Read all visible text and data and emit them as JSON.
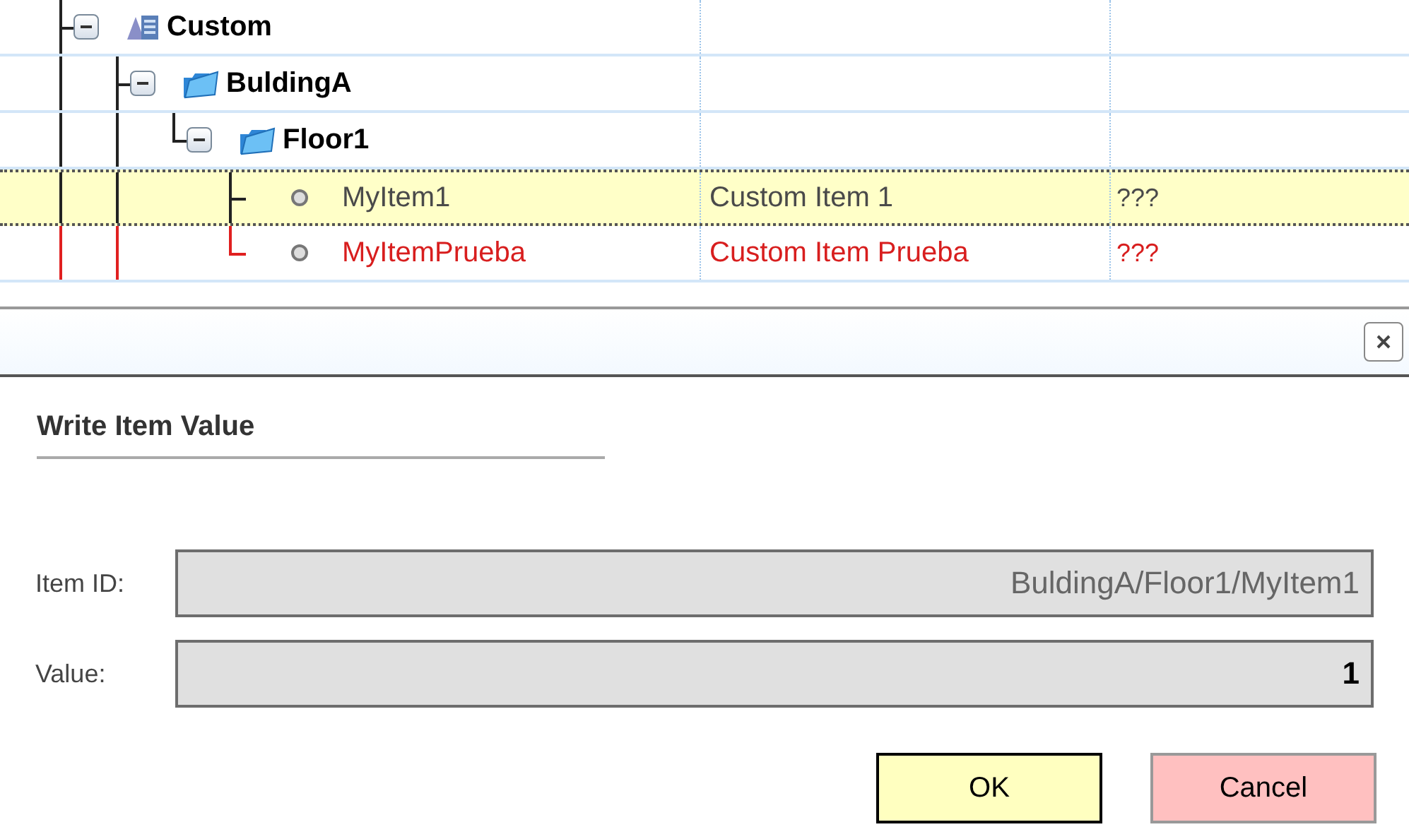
{
  "tree": [
    {
      "label": "Custom",
      "kind": "custom",
      "expanded": true,
      "last": false,
      "children": [
        {
          "label": "BuldingA",
          "kind": "folder",
          "expanded": true,
          "last": false,
          "children": [
            {
              "label": "Floor1",
              "kind": "folder",
              "expanded": true,
              "last": true,
              "children": [
                {
                  "label": "MyItem1",
                  "kind": "item",
                  "selected": true,
                  "error": false,
                  "last": false,
                  "description": "Custom Item 1",
                  "value": "???"
                },
                {
                  "label": "MyItemPrueba",
                  "kind": "item",
                  "selected": false,
                  "error": true,
                  "last": true,
                  "description": "Custom Item Prueba",
                  "value": "???"
                }
              ]
            }
          ]
        }
      ]
    }
  ],
  "dialog": {
    "title": "Write Item Value",
    "fields": [
      {
        "label": "Item ID:",
        "value": "BuldingA/Floor1/MyItem1",
        "kind": "readonly"
      },
      {
        "label": "Value:",
        "value": "1",
        "kind": "editable"
      }
    ],
    "buttons": [
      {
        "label": "OK",
        "kind": "primary"
      },
      {
        "label": "Cancel",
        "kind": "cancel"
      }
    ]
  }
}
